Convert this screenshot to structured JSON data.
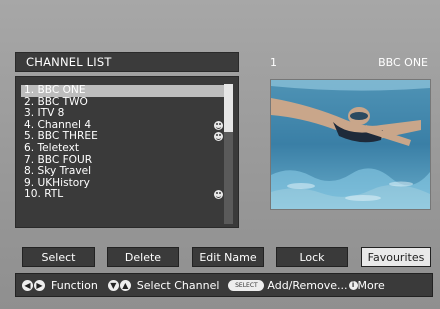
{
  "header": {
    "title": "CHANNEL LIST"
  },
  "preview": {
    "number": "1",
    "name": "BBC ONE"
  },
  "channels": [
    {
      "label": "1. BBC ONE",
      "favourite": false,
      "selected": true
    },
    {
      "label": "2. BBC TWO",
      "favourite": false
    },
    {
      "label": "3. ITV 8",
      "favourite": false
    },
    {
      "label": "4. Channel 4",
      "favourite": true
    },
    {
      "label": "5. BBC THREE",
      "favourite": true
    },
    {
      "label": "6. Teletext",
      "favourite": false
    },
    {
      "label": "7. BBC FOUR",
      "favourite": false
    },
    {
      "label": "8. Sky Travel",
      "favourite": false
    },
    {
      "label": "9. UKHistory",
      "favourite": false
    },
    {
      "label": "10. RTL",
      "favourite": true
    }
  ],
  "buttons": {
    "select": "Select",
    "delete": "Delete",
    "edit_name": "Edit Name",
    "lock": "Lock",
    "favourites": "Favourites"
  },
  "footer": {
    "function_label": "Function",
    "select_channel_label": "Select Channel",
    "select_key": "SELECT",
    "add_remove_label": "Add/Remove...",
    "more_label": "More",
    "info_key": "i"
  },
  "colors": {
    "panel": "#3a3a3a",
    "highlight": "#bdbdbd",
    "favourites_button": "#e9e9e9"
  }
}
